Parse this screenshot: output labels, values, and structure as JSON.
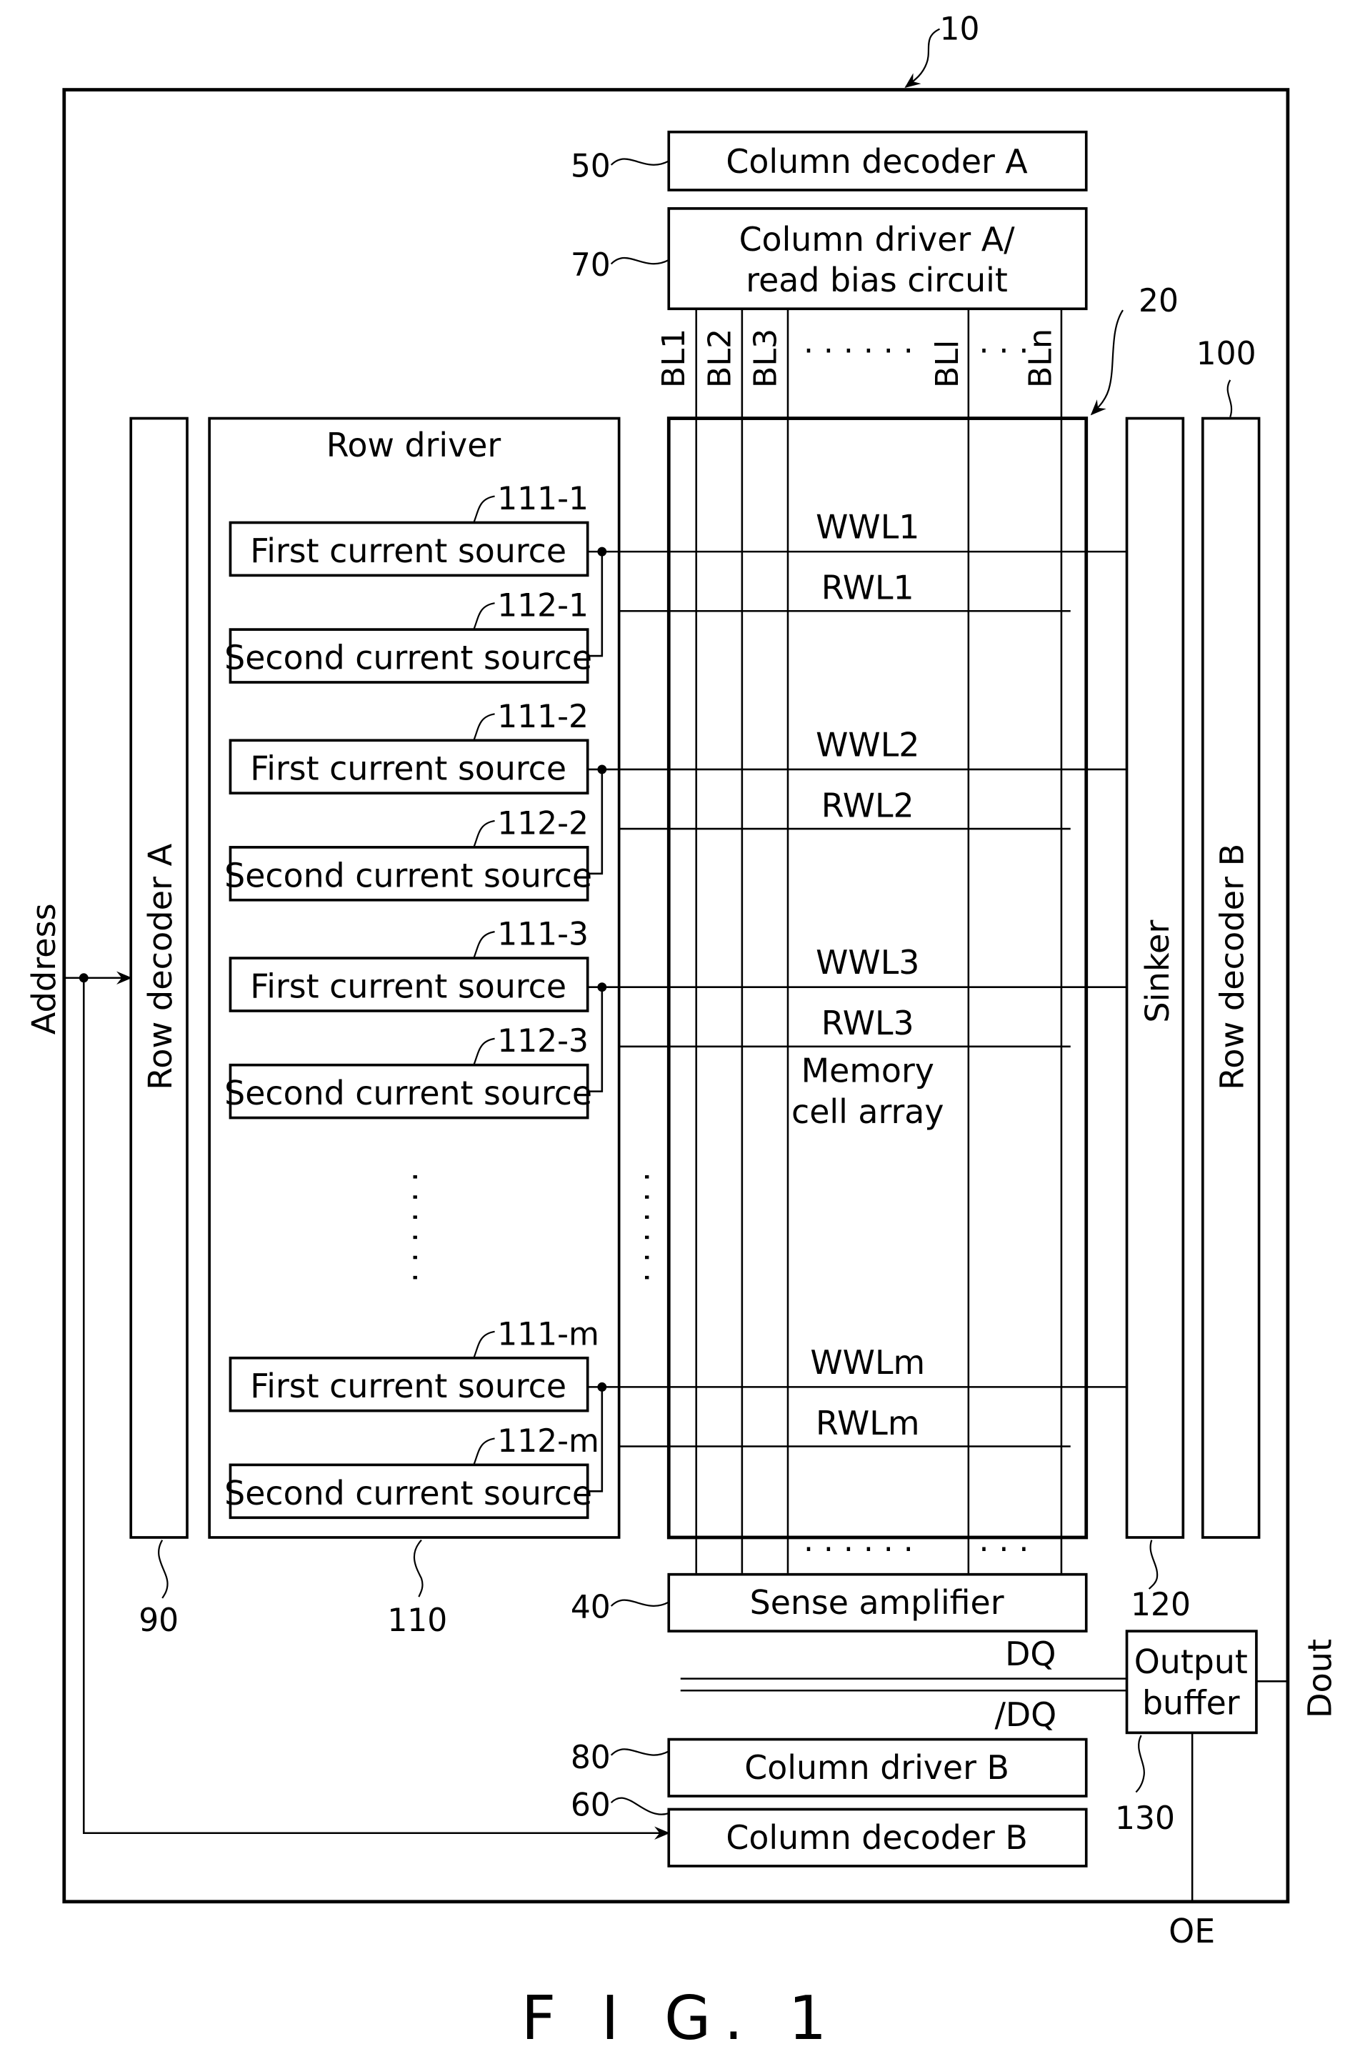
{
  "figure": {
    "caption": "F I G. 1",
    "device_ref": "10",
    "array_ref": "20"
  },
  "blocks": {
    "column_decoder_a": {
      "label": "Column decoder A",
      "ref": "50"
    },
    "column_driver_a": {
      "label_line1": "Column driver A/",
      "label_line2": "read bias circuit",
      "ref": "70"
    },
    "row_decoder_a": {
      "label": "Row decoder A",
      "ref": "90"
    },
    "row_driver": {
      "label": "Row driver",
      "ref": "110"
    },
    "memory_cell_array": {
      "label_line1": "Memory",
      "label_line2": "cell array"
    },
    "sinker": {
      "label": "Sinker",
      "ref": "120"
    },
    "row_decoder_b": {
      "label": "Row decoder B",
      "ref": "100"
    },
    "sense_amplifier": {
      "label": "Sense amplifier",
      "ref": "40"
    },
    "output_buffer": {
      "label_line1": "Output",
      "label_line2": "buffer",
      "ref": "130"
    },
    "column_driver_b": {
      "label": "Column driver B",
      "ref": "80"
    },
    "column_decoder_b": {
      "label": "Column decoder B",
      "ref": "60"
    }
  },
  "current_sources": [
    {
      "first_label": "First current source",
      "first_ref": "111-1",
      "second_label": "Second current source",
      "second_ref": "112-1",
      "wwl": "WWL1",
      "rwl": "RWL1"
    },
    {
      "first_label": "First current source",
      "first_ref": "111-2",
      "second_label": "Second current source",
      "second_ref": "112-2",
      "wwl": "WWL2",
      "rwl": "RWL2"
    },
    {
      "first_label": "First current source",
      "first_ref": "111-3",
      "second_label": "Second current source",
      "second_ref": "112-3",
      "wwl": "WWL3",
      "rwl": "RWL3"
    },
    {
      "first_label": "First current source",
      "first_ref": "111-m",
      "second_label": "Second current source",
      "second_ref": "112-m",
      "wwl": "WWLm",
      "rwl": "RWLm"
    }
  ],
  "bit_lines": [
    "BL1",
    "BL2",
    "BL3",
    "BLl",
    "BLn"
  ],
  "ellipsis": {
    "bitline_gap_main": "· · · · · ·",
    "bitline_gap_small": "· · ·"
  },
  "signals": {
    "address": "Address",
    "dq": "DQ",
    "dq_bar": "/DQ",
    "dout": "Dout",
    "oe": "OE"
  }
}
